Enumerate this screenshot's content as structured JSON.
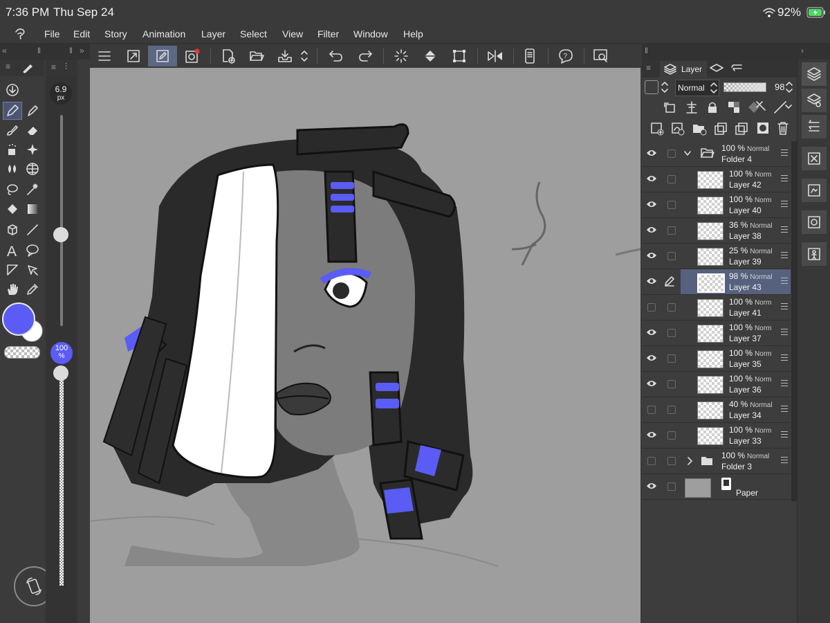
{
  "status": {
    "time": "7:36 PM",
    "date": "Thu Sep 24",
    "battery": "92%"
  },
  "menu": [
    "File",
    "Edit",
    "Story",
    "Animation",
    "Layer",
    "Select",
    "View",
    "Filter",
    "Window",
    "Help"
  ],
  "brush": {
    "size_value": "6.9",
    "size_unit": "px",
    "opacity_value": "100",
    "opacity_unit": "%"
  },
  "colors": {
    "main": "#5a5cf5",
    "sub": "#ffffff",
    "accent": "#5b6783"
  },
  "layer_panel": {
    "tab_label": "Layer",
    "blend_mode": "Normal",
    "opacity": "98",
    "layers": [
      {
        "pct": "100 %",
        "mode": "Normal",
        "name": "Folder 4",
        "type": "folder",
        "expanded": true,
        "visible": true,
        "selected": false
      },
      {
        "pct": "100 %",
        "mode": "Norm",
        "name": "Layer 42",
        "type": "layer",
        "visible": true,
        "selected": false
      },
      {
        "pct": "100 %",
        "mode": "Norm",
        "name": "Layer 40",
        "type": "layer",
        "visible": true,
        "selected": false
      },
      {
        "pct": "36 %",
        "mode": "Normal",
        "name": "Layer 38",
        "type": "layer",
        "visible": true,
        "selected": false
      },
      {
        "pct": "25 %",
        "mode": "Normal",
        "name": "Layer 39",
        "type": "layer",
        "visible": true,
        "selected": false
      },
      {
        "pct": "98 %",
        "mode": "Normal",
        "name": "Layer 43",
        "type": "layer",
        "visible": true,
        "selected": true
      },
      {
        "pct": "100 %",
        "mode": "Norm",
        "name": "Layer 41",
        "type": "layer",
        "visible": false,
        "selected": false
      },
      {
        "pct": "100 %",
        "mode": "Norm",
        "name": "Layer 37",
        "type": "layer",
        "visible": true,
        "selected": false
      },
      {
        "pct": "100 %",
        "mode": "Norm",
        "name": "Layer 35",
        "type": "layer",
        "visible": true,
        "selected": false
      },
      {
        "pct": "100 %",
        "mode": "Norm",
        "name": "Layer 36",
        "type": "layer",
        "visible": true,
        "selected": false
      },
      {
        "pct": "40 %",
        "mode": "Normal",
        "name": "Layer 34",
        "type": "layer",
        "visible": false,
        "selected": false
      },
      {
        "pct": "100 %",
        "mode": "Norm",
        "name": "Layer 33",
        "type": "layer",
        "visible": true,
        "selected": false
      },
      {
        "pct": "100 %",
        "mode": "Normal",
        "name": "Folder 3",
        "type": "folder",
        "expanded": false,
        "visible": false,
        "selected": false
      },
      {
        "pct": "",
        "mode": "",
        "name": "Paper",
        "type": "paper",
        "visible": true,
        "selected": false
      }
    ]
  }
}
